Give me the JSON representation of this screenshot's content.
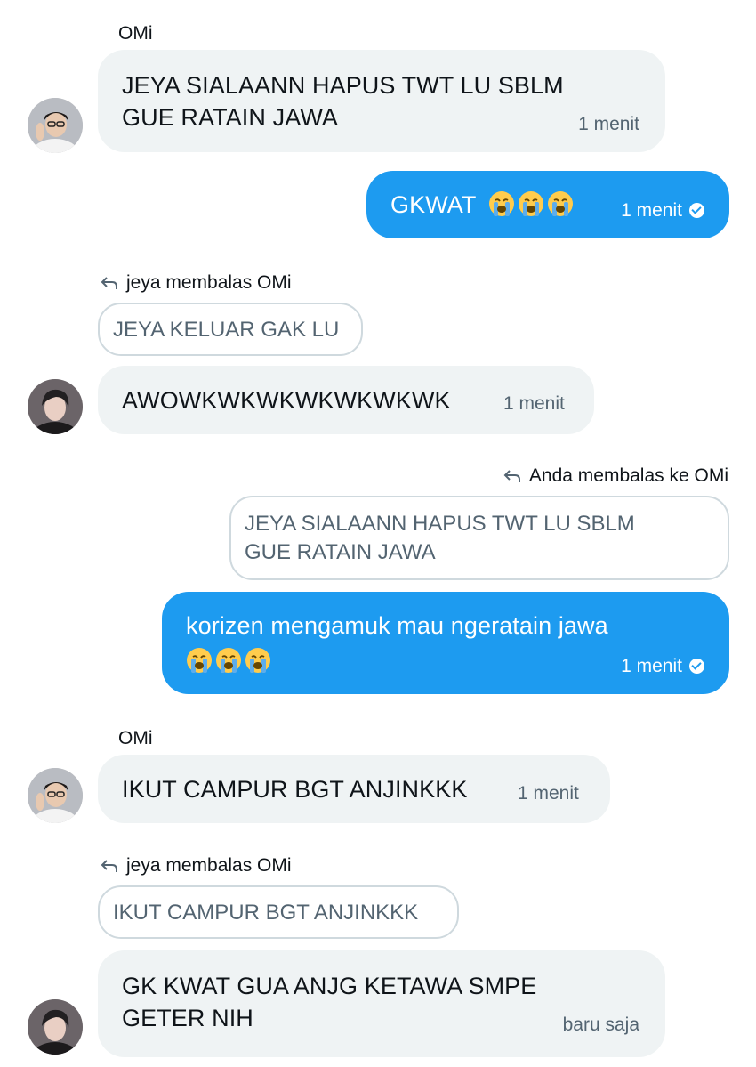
{
  "messages": [
    {
      "sender": "OMi",
      "text_lines": [
        "JEYA SIALAANN HAPUS TWT LU SBLM",
        "GUE RATAIN JAWA"
      ],
      "time": "1 menit"
    },
    {
      "text": "GKWAT",
      "emoji": "loudly-crying-face x3",
      "time": "1 menit"
    },
    {
      "reply_label": "jeya membalas OMi",
      "quoted": "JEYA KELUAR GAK LU",
      "text": "AWOWKWKWKWKWKWKWK",
      "time": "1 menit"
    },
    {
      "reply_label": "Anda membalas ke OMi",
      "quoted_lines": [
        "JEYA SIALAANN HAPUS TWT LU SBLM",
        "GUE RATAIN JAWA"
      ],
      "text": "korizen mengamuk mau ngeratain jawa",
      "emoji": "loudly-crying-face x3",
      "time": "1 menit"
    },
    {
      "sender": "OMi",
      "text": "IKUT CAMPUR BGT ANJINKKK",
      "time": "1 menit"
    },
    {
      "reply_label": "jeya membalas OMi",
      "quoted": "IKUT CAMPUR BGT ANJINKKK",
      "text_lines": [
        "GK KWAT GUA ANJG KETAWA SMPE",
        "GETER NIH"
      ],
      "time": "baru saja"
    }
  ],
  "colors": {
    "outgoing_bubble": "#1d9bf0",
    "incoming_bubble": "#eff3f4",
    "timestamp": "#536471",
    "quote_border": "#cfd9de"
  },
  "icons": [
    "reply-arrow-icon",
    "sent-check-icon",
    "loudly-crying-face-emoji"
  ]
}
